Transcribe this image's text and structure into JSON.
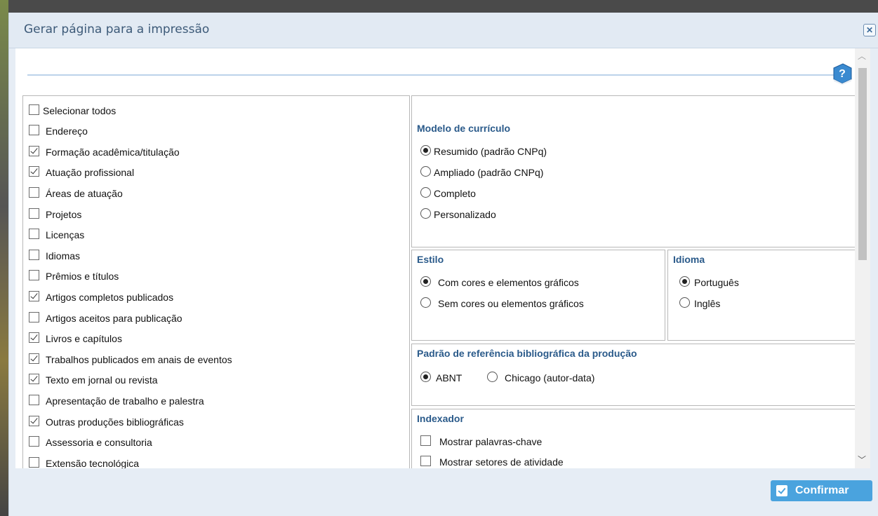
{
  "dialog": {
    "title": "Gerar página para a impressão",
    "close_icon": "collapse-icon",
    "help_icon": "help-book-icon"
  },
  "sections": {
    "checkbox_items": [
      {
        "label": "Selecionar todos",
        "checked": false
      },
      {
        "label": "Endereço",
        "checked": false
      },
      {
        "label": "Formação acadêmica/titulação",
        "checked": true
      },
      {
        "label": "Atuação profissional",
        "checked": true
      },
      {
        "label": "Áreas de atuação",
        "checked": false
      },
      {
        "label": "Projetos",
        "checked": false
      },
      {
        "label": "Licenças",
        "checked": false
      },
      {
        "label": "Idiomas",
        "checked": false
      },
      {
        "label": "Prêmios e títulos",
        "checked": false
      },
      {
        "label": "Artigos completos publicados",
        "checked": true
      },
      {
        "label": "Artigos aceitos para publicação",
        "checked": false
      },
      {
        "label": "Livros e capítulos",
        "checked": true
      },
      {
        "label": "Trabalhos publicados em anais de eventos",
        "checked": true
      },
      {
        "label": "Texto em jornal ou revista",
        "checked": true
      },
      {
        "label": "Apresentação de trabalho e palestra",
        "checked": false
      },
      {
        "label": "Outras produções bibliográficas",
        "checked": true
      },
      {
        "label": "Assessoria e consultoria",
        "checked": false
      },
      {
        "label": "Extensão tecnológica",
        "checked": false
      }
    ]
  },
  "modelo": {
    "title": "Modelo de currículo",
    "options": [
      "Resumido (padrão CNPq)",
      "Ampliado (padrão CNPq)",
      "Completo",
      "Personalizado"
    ],
    "selected": "Resumido (padrão CNPq)"
  },
  "estilo": {
    "title": "Estilo",
    "options": [
      "Com cores e elementos gráficos",
      "Sem cores ou elementos gráficos"
    ],
    "selected": "Com cores e elementos gráficos"
  },
  "idioma": {
    "title": "Idioma",
    "options": [
      "Português",
      "Inglês"
    ],
    "selected": "Português"
  },
  "padrao": {
    "title": "Padrão de referência bibliográfica da produção",
    "options": [
      "ABNT",
      "Chicago (autor-data)"
    ],
    "selected": "ABNT"
  },
  "indexador": {
    "title": "Indexador",
    "options": [
      "Mostrar palavras-chave",
      "Mostrar setores de atividade"
    ]
  },
  "footer": {
    "confirm_label": "Confirmar"
  }
}
